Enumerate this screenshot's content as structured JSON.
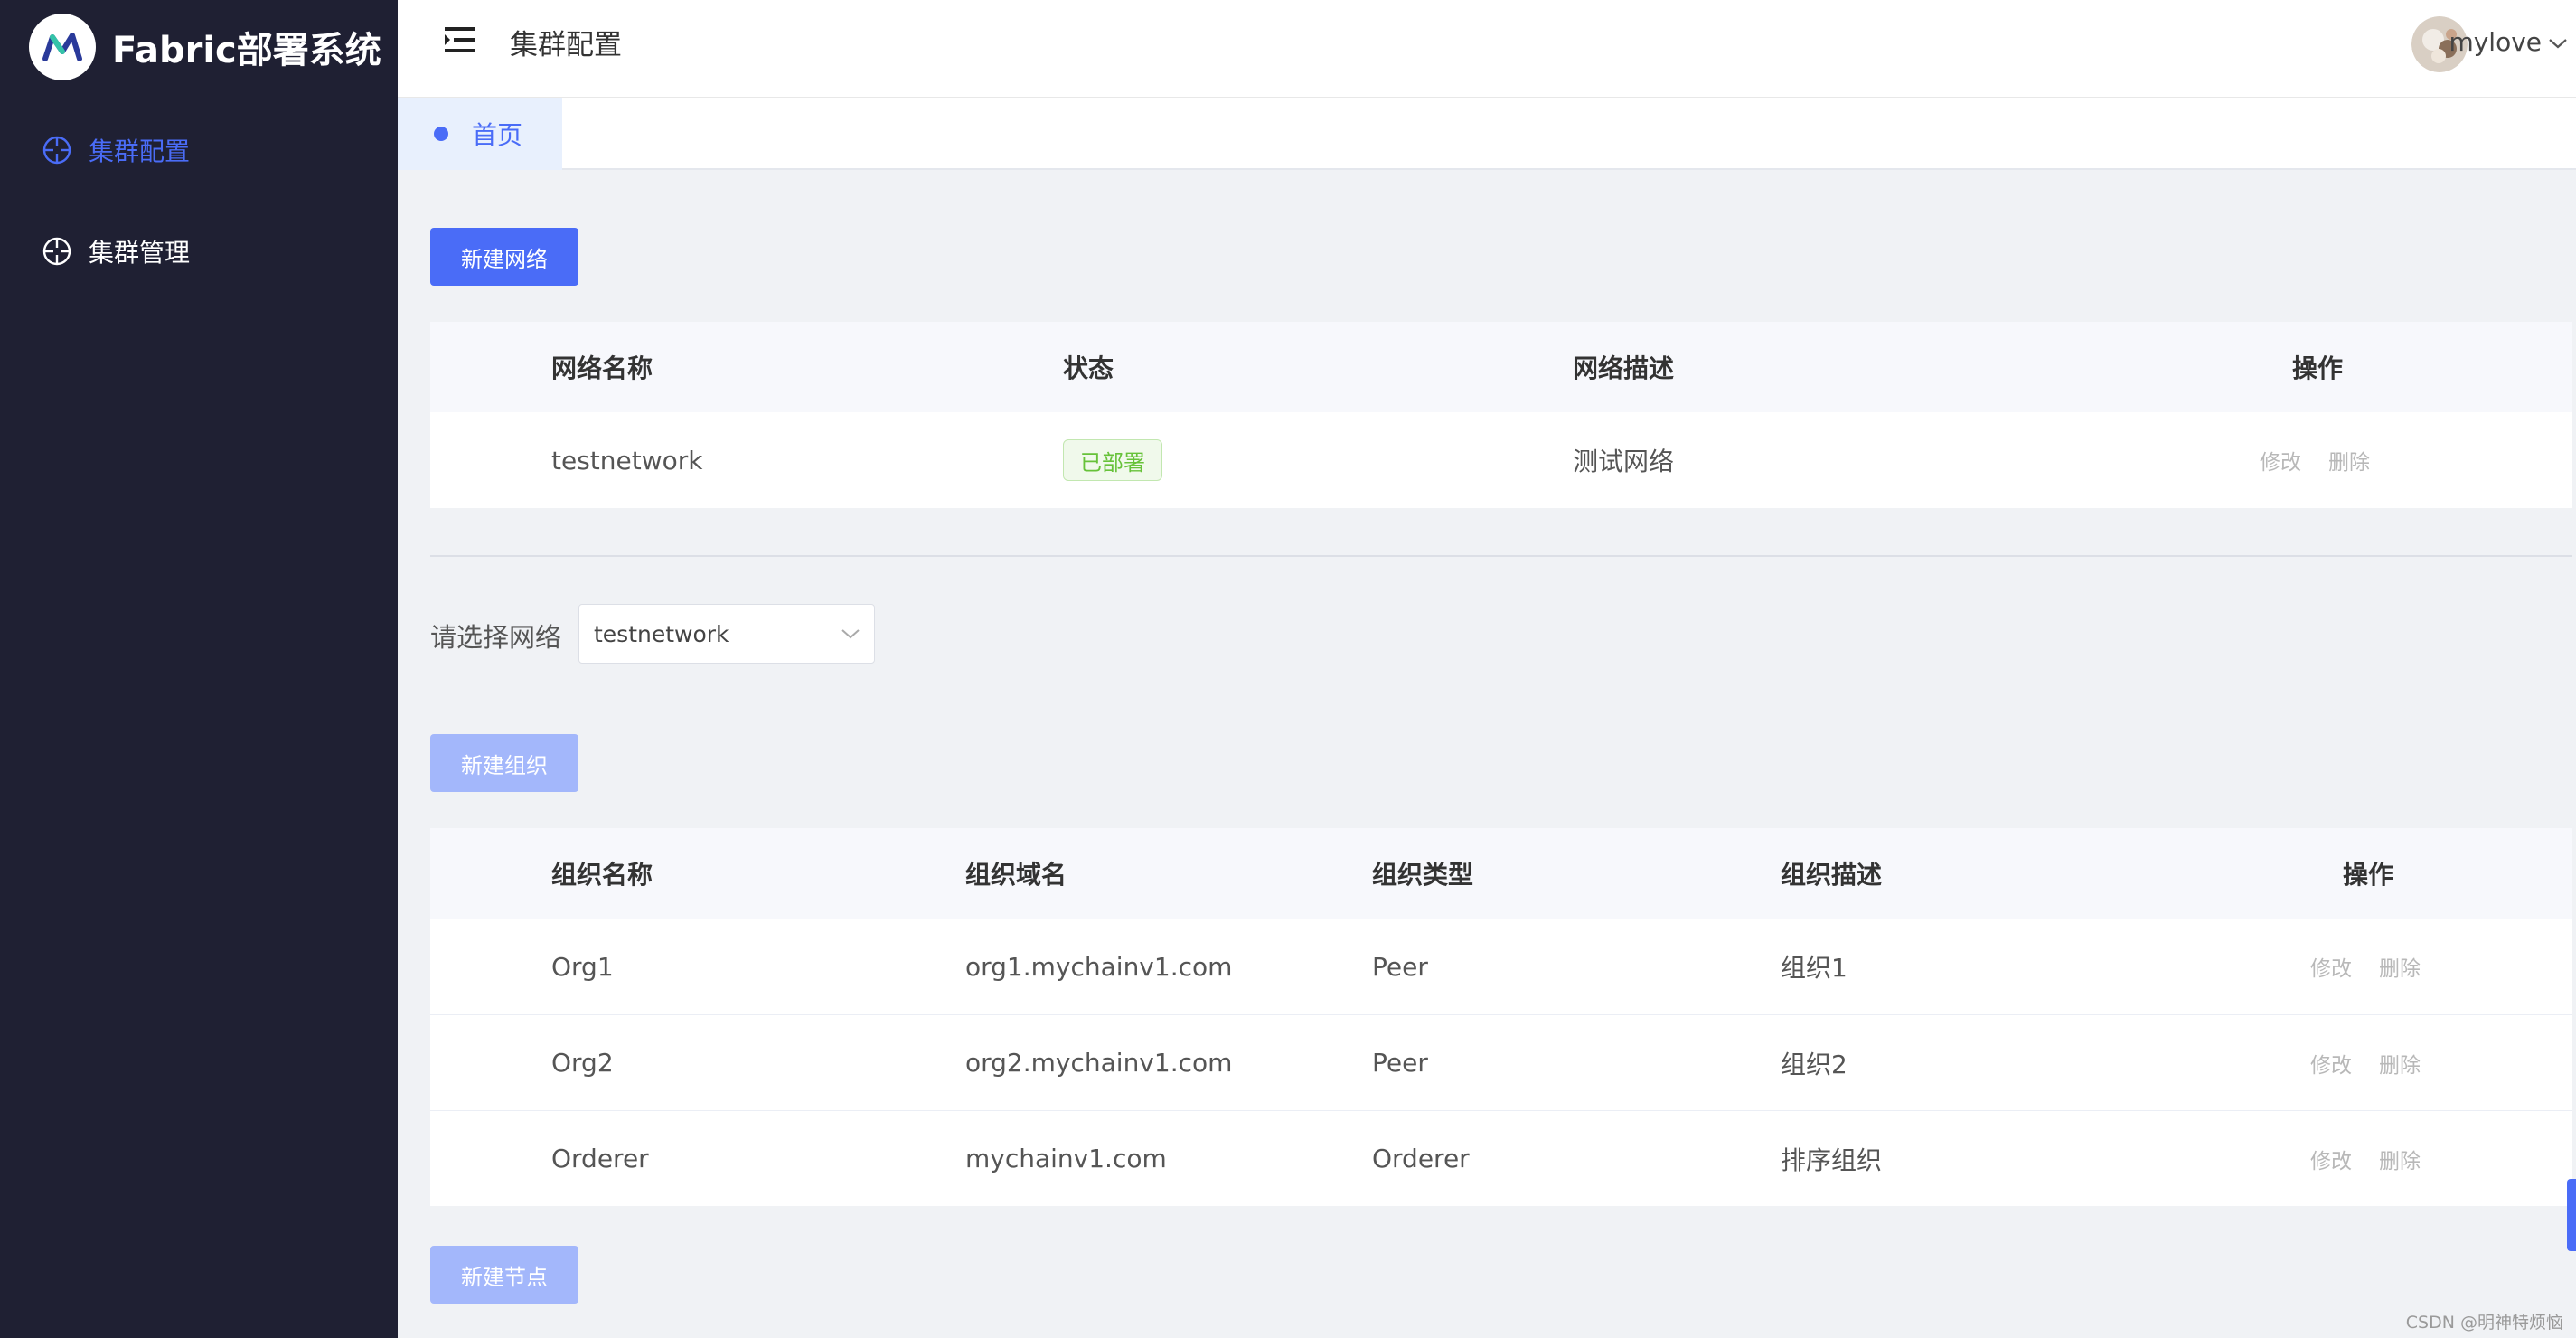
{
  "app": {
    "title": "Fabric部署系统",
    "logo_icon": "stylized-w-logo-icon"
  },
  "sidebar": {
    "items": [
      {
        "label": "集群配置",
        "icon": "crosshair-icon",
        "active": true
      },
      {
        "label": "集群管理",
        "icon": "crosshair-icon",
        "active": false
      }
    ]
  },
  "header": {
    "title": "集群配置",
    "username": "mylove",
    "menu_icon": "hamburger-icon"
  },
  "tabs": [
    {
      "label": "首页",
      "active": true
    }
  ],
  "network_section": {
    "new_button": "新建网络",
    "columns": [
      "网络名称",
      "状态",
      "网络描述",
      "操作"
    ],
    "rows": [
      {
        "name": "testnetwork",
        "status": "已部署",
        "description": "测试网络",
        "actions": [
          "修改",
          "删除"
        ]
      }
    ]
  },
  "network_select": {
    "label": "请选择网络",
    "value": "testnetwork"
  },
  "org_section": {
    "new_button": "新建组织",
    "columns": [
      "组织名称",
      "组织域名",
      "组织类型",
      "组织描述",
      "操作"
    ],
    "rows": [
      {
        "name": "Org1",
        "domain": "org1.mychainv1.com",
        "type": "Peer",
        "description": "组织1",
        "actions": [
          "修改",
          "删除"
        ]
      },
      {
        "name": "Org2",
        "domain": "org2.mychainv1.com",
        "type": "Peer",
        "description": "组织2",
        "actions": [
          "修改",
          "删除"
        ]
      },
      {
        "name": "Orderer",
        "domain": "mychainv1.com",
        "type": "Orderer",
        "description": "排序组织",
        "actions": [
          "修改",
          "删除"
        ]
      }
    ]
  },
  "node_section": {
    "new_button": "新建节点"
  },
  "watermark": "CSDN @明神特烦恼",
  "colors": {
    "sidebar_bg": "#1f2033",
    "accent": "#4a6cf7",
    "success": "#67c23a",
    "content_bg": "#f0f2f5"
  }
}
